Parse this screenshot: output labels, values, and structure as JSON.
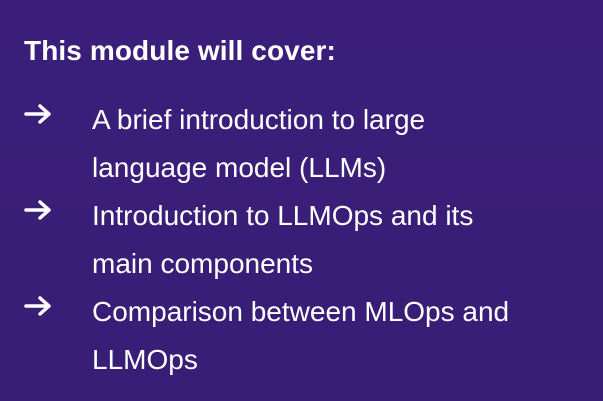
{
  "slide": {
    "title": "This module will cover:",
    "bullets": [
      {
        "icon": "arrow-right-icon",
        "lines": [
          "A brief introduction to large",
          "language model (LLMs)"
        ]
      },
      {
        "icon": "arrow-right-icon",
        "lines": [
          "Introduction to LLMOps and its",
          "main components"
        ]
      },
      {
        "icon": "arrow-right-icon",
        "lines": [
          "Comparison between MLOps and",
          "LLMOps"
        ]
      }
    ]
  },
  "colors": {
    "background": "#3a1f7a",
    "text": "#ffffff"
  }
}
